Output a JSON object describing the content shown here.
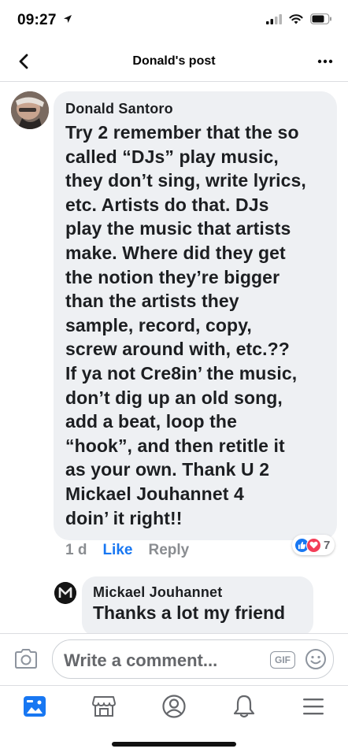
{
  "status_bar": {
    "time": "09:27"
  },
  "nav": {
    "title": "Donald's post"
  },
  "comment": {
    "author": "Donald Santoro",
    "text": "Try 2 remember that the so\ncalled “DJs” play music,\nthey don’t sing, write lyrics,\netc.  Artists do that.  DJs\nplay the music that artists\nmake.  Where did they get\nthe notion they’re bigger\nthan the artists they\nsample, record, copy,\nscrew around with, etc.??\nIf ya not Cre8in’ the music,\ndon’t dig up an old song,\nadd a beat, loop the\n“hook”, and then retitle it\nas your own.  Thank U 2\n",
    "mention": "Mickael Jouhannet",
    "text_after_mention": " 4\ndoin’ it right!!",
    "time": "1 d",
    "like_label": "Like",
    "reply_label": "Reply",
    "reactions": {
      "icons": [
        "like-icon",
        "love-icon"
      ],
      "count": "7"
    }
  },
  "reply": {
    "author": "Mickael Jouhannet",
    "text": "Thanks a lot my friend"
  },
  "composer": {
    "placeholder": "Write a comment...",
    "gif_label": "GIF"
  },
  "tabs": [
    "news-feed-icon",
    "marketplace-icon",
    "profile-icon",
    "notifications-icon",
    "menu-icon"
  ],
  "colors": {
    "accent": "#1877f2",
    "love": "#f33e58",
    "bubble": "#eef0f3",
    "muted": "#8a8d91"
  }
}
